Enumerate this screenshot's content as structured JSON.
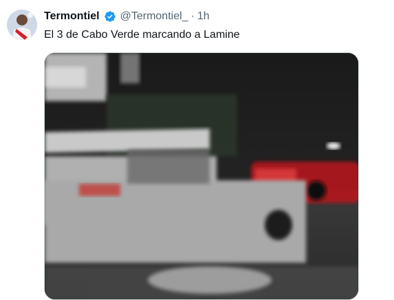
{
  "tweet": {
    "author_name": "Termontiel",
    "handle": "@Termontiel_",
    "separator": "·",
    "time": "1h",
    "text": "El 3 de Cabo Verde marcando a Lamine",
    "verified": true
  },
  "media": {
    "type": "video-frame",
    "icon": "video-thumbnail"
  },
  "colors": {
    "verified_badge": "#1d9bf0",
    "text_primary": "#0f1419",
    "text_secondary": "#536471",
    "border": "#cfd9de"
  }
}
